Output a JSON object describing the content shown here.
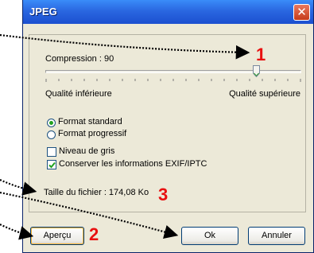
{
  "window": {
    "title": "JPEG",
    "close_glyph": "✕"
  },
  "compression": {
    "label": "Compression : 90",
    "value": 90,
    "min_label": "Qualité inférieure",
    "max_label": "Qualité supérieure"
  },
  "format": {
    "options": [
      "Format standard",
      "Format progressif"
    ],
    "selected": "Format standard"
  },
  "options": {
    "grayscale_label": "Niveau de gris",
    "grayscale_checked": false,
    "exif_label": "Conserver les informations EXIF/IPTC",
    "exif_checked": true
  },
  "file_size": {
    "label": "Taille du fichier : 174,08 Ko"
  },
  "buttons": {
    "preview": "Aperçu",
    "ok": "Ok",
    "cancel": "Annuler"
  },
  "annotations": {
    "marker_1": "1",
    "marker_2": "2",
    "marker_3": "3",
    "color": "#E81010"
  },
  "icons": {
    "close": "close-icon",
    "checkmark": "checkmark-icon"
  }
}
